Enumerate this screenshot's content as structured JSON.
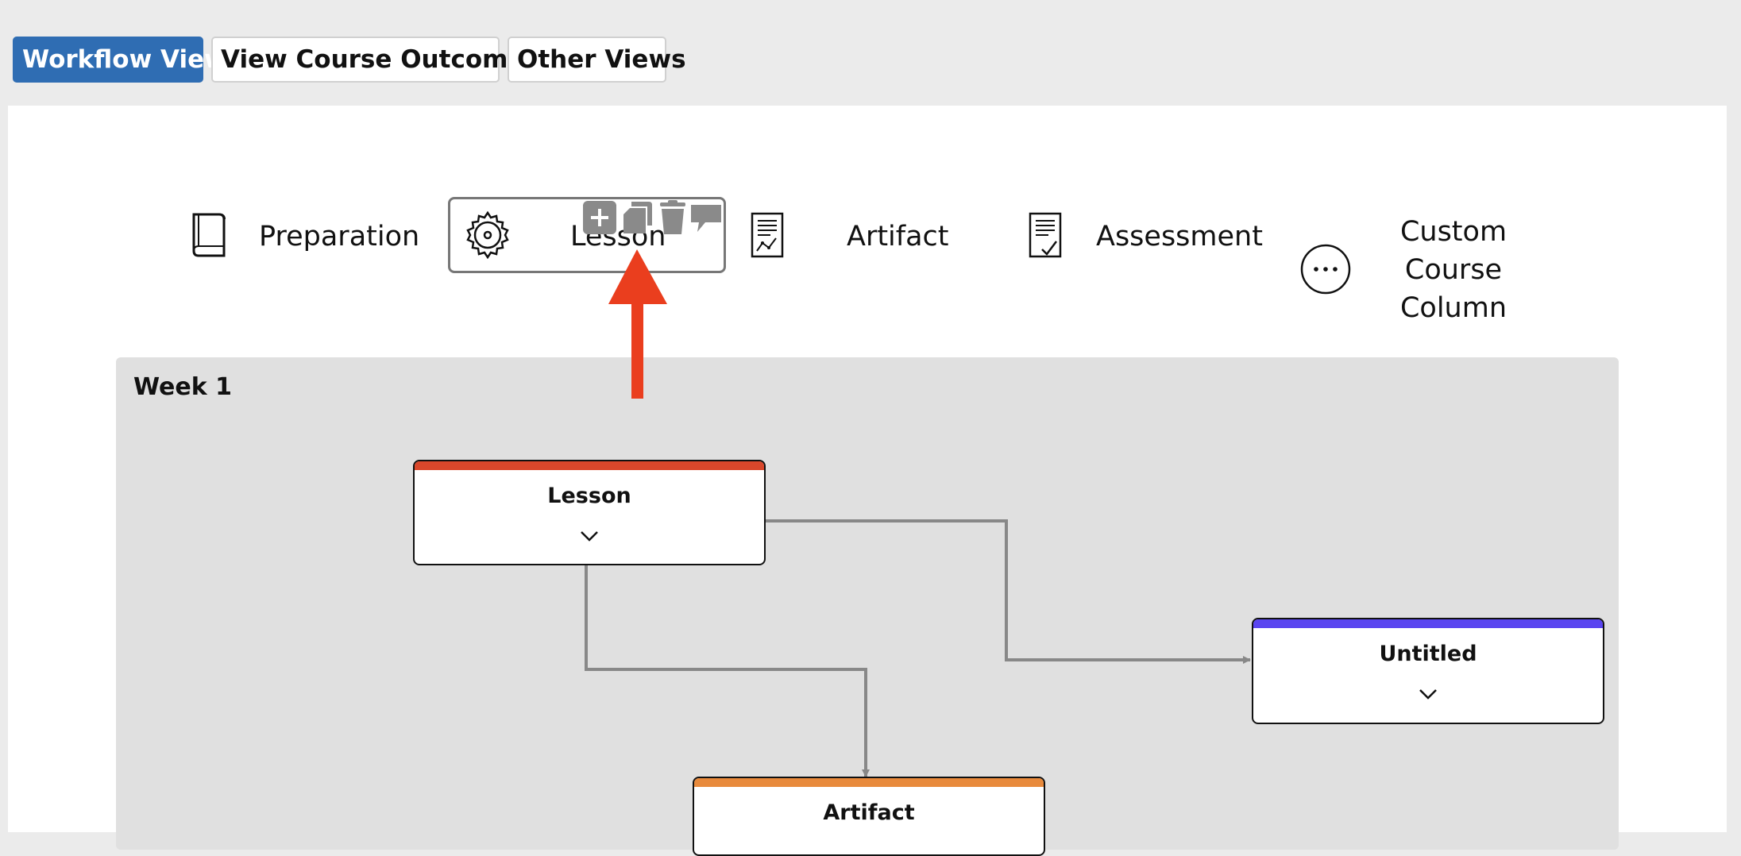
{
  "tabs": {
    "workflow_view": "Workflow View",
    "course_outcomes": "View Course Outcomes",
    "other_views": "Other Views"
  },
  "columns": [
    {
      "label": "Preparation",
      "icon": "book-icon"
    },
    {
      "label": "Lesson",
      "icon": "gear-icon"
    },
    {
      "label": "Artifact",
      "icon": "document-chart-icon"
    },
    {
      "label": "Assessment",
      "icon": "document-check-icon"
    },
    {
      "label": "Custom Course Column",
      "icon": "ellipsis-circle-icon"
    }
  ],
  "column_actions": [
    "add-icon",
    "duplicate-icon",
    "delete-icon",
    "comment-icon"
  ],
  "week": {
    "title": "Week 1"
  },
  "nodes": [
    {
      "title": "Lesson",
      "color": "#d9472b"
    },
    {
      "title": "Untitled",
      "color": "#5a45f0"
    },
    {
      "title": "Artifact",
      "color": "#e88a3c"
    }
  ],
  "colors": {
    "active_tab": "#2f6db3",
    "annotation_arrow": "#ea3e1e",
    "connector": "#888888",
    "action_icon": "#8a8a8a"
  }
}
